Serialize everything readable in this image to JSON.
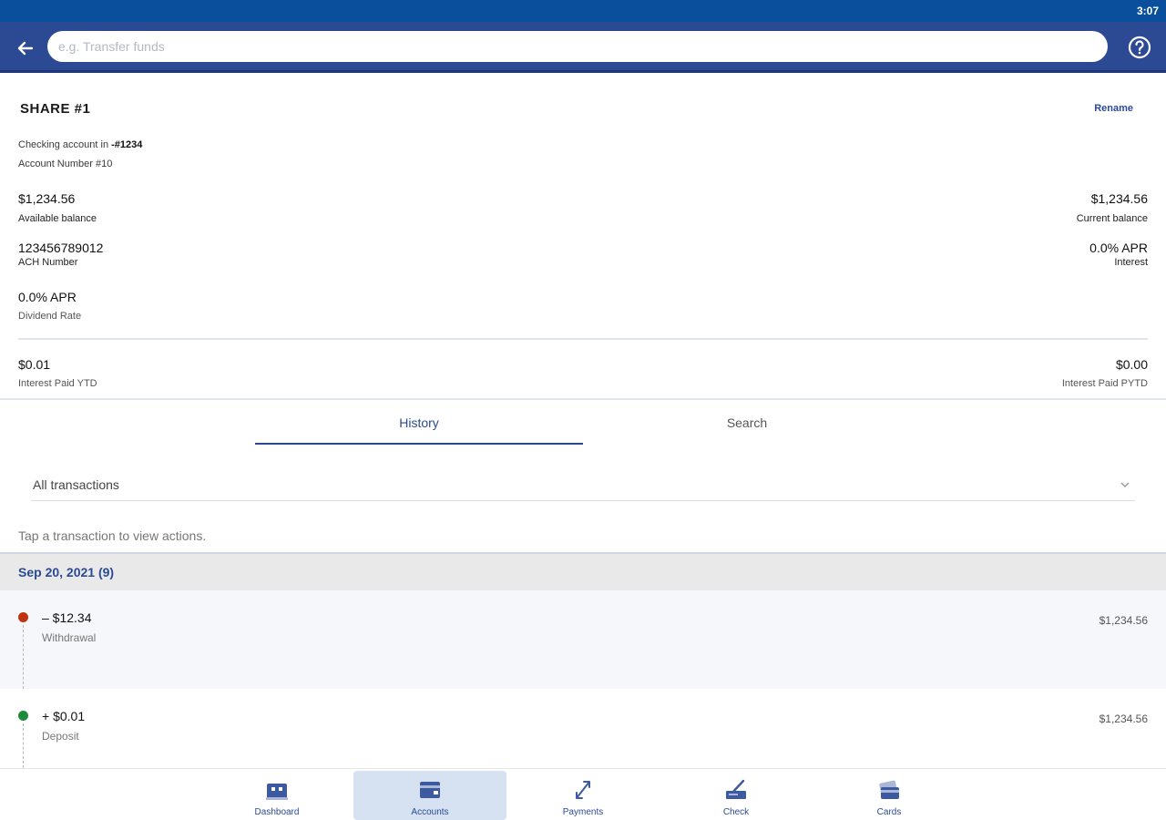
{
  "status": {
    "time": "3:07"
  },
  "header": {
    "search_placeholder": "e.g. Transfer funds",
    "back_icon": "arrow-left-icon",
    "help_icon": "question-circle-icon"
  },
  "account": {
    "title": "SHARE #1",
    "rename_label": "Rename",
    "checking_prefix": "Checking account in ",
    "checking_suffix": "-#1234",
    "account_number": "Account Number #10",
    "available_balance": "$1,234.56",
    "available_balance_label": "Available balance",
    "current_balance": "$1,234.56",
    "current_balance_label": "Current balance",
    "ach_number": "123456789012",
    "ach_label": "ACH Number",
    "interest_rate": "0.0% APR",
    "interest_label": "Interest",
    "dividend_rate": "0.0% APR",
    "dividend_label": "Dividend Rate",
    "interest_paid_ytd": "$0.01",
    "interest_paid_ytd_label": "Interest Paid YTD",
    "interest_paid_pytd": "$0.00",
    "interest_paid_pytd_label": "Interest Paid PYTD"
  },
  "tabs": [
    {
      "label": "History",
      "active": true
    },
    {
      "label": "Search",
      "active": false
    }
  ],
  "filter": {
    "value": "All transactions"
  },
  "hint": "Tap a transaction to view actions.",
  "transactions": {
    "date_header": "Sep 20, 2021 (9)",
    "items": [
      {
        "amount": "– $12.34",
        "description": "Withdrawal",
        "balance": "$1,234.56",
        "dot_color": "#c0330f"
      },
      {
        "amount": "+ $0.01",
        "description": "Deposit",
        "balance": "$1,234.56",
        "dot_color": "#1e8a3c"
      }
    ]
  },
  "bottom_nav": [
    {
      "label": "Dashboard",
      "icon": "bank-icon",
      "active": false
    },
    {
      "label": "Accounts",
      "icon": "wallet-icon",
      "active": true
    },
    {
      "label": "Payments",
      "icon": "transfer-arrows-icon",
      "active": false
    },
    {
      "label": "Check",
      "icon": "check-deposit-icon",
      "active": false
    },
    {
      "label": "Cards",
      "icon": "cards-icon",
      "active": false
    }
  ],
  "colors": {
    "primary": "#2b4a93",
    "status_bar": "#0a4f9c",
    "withdrawal": "#c0330f",
    "deposit": "#1e8a3c",
    "nav_active_bg": "#d6e1f1"
  }
}
